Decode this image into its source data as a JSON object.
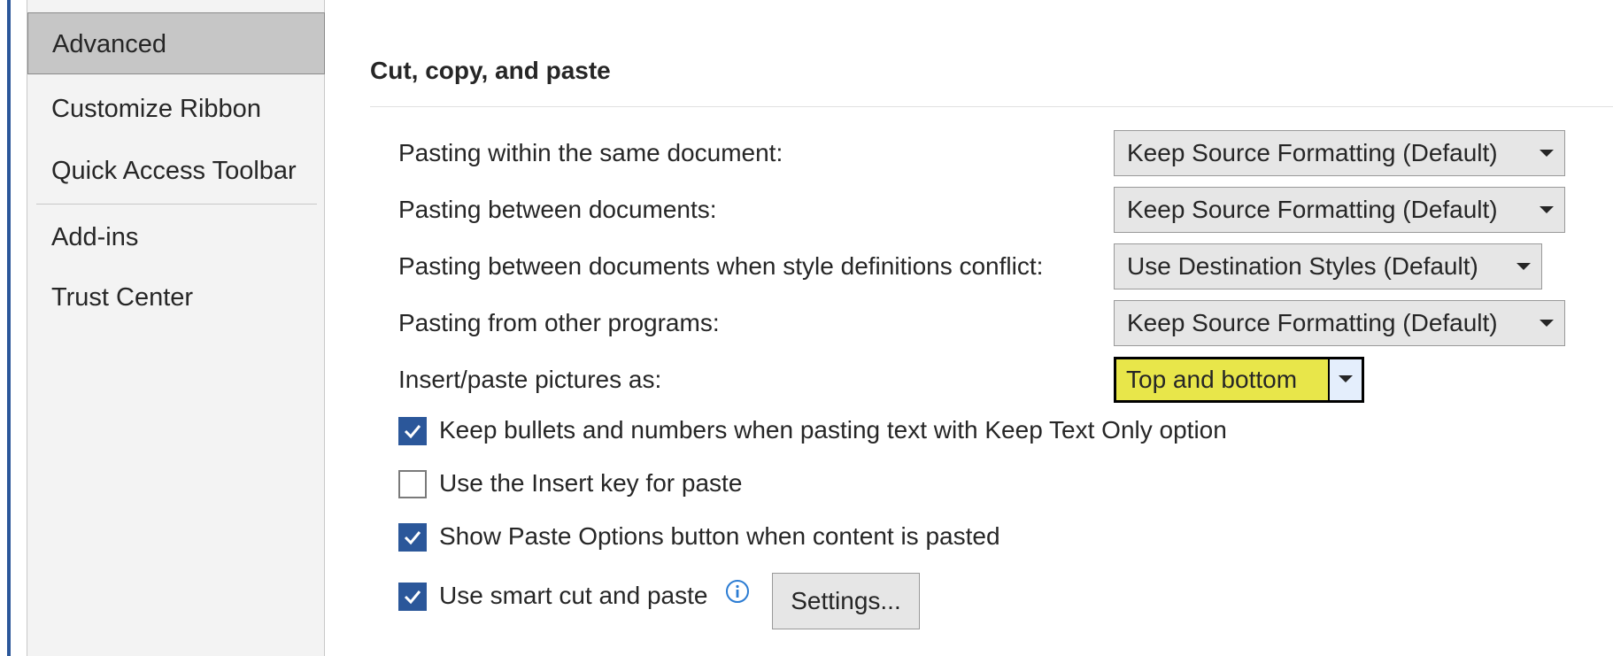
{
  "sidebar": {
    "items": [
      {
        "label": "Advanced"
      },
      {
        "label": "Customize Ribbon"
      },
      {
        "label": "Quick Access Toolbar"
      },
      {
        "label": "Add-ins"
      },
      {
        "label": "Trust Center"
      }
    ]
  },
  "section": {
    "title": "Cut, copy, and paste"
  },
  "paste_options": {
    "within_document": {
      "label": "Pasting within the same document:",
      "value": "Keep Source Formatting (Default)"
    },
    "between_documents": {
      "label": "Pasting between documents:",
      "value": "Keep Source Formatting (Default)"
    },
    "style_conflict": {
      "label": "Pasting between documents when style definitions conflict:",
      "value": "Use Destination Styles (Default)"
    },
    "other_programs": {
      "label": "Pasting from other programs:",
      "value": "Keep Source Formatting (Default)"
    },
    "pictures": {
      "label": "Insert/paste pictures as:",
      "value": "Top and bottom"
    }
  },
  "checkboxes": {
    "keep_bullets": {
      "label": "Keep bullets and numbers when pasting text with Keep Text Only option",
      "checked": true
    },
    "insert_key": {
      "label": "Use the Insert key for paste",
      "checked": false
    },
    "paste_options_button": {
      "label": "Show Paste Options button when content is pasted",
      "checked": true
    },
    "smart_cut": {
      "label": "Use smart cut and paste",
      "checked": true
    }
  },
  "buttons": {
    "settings_label": "Settings..."
  },
  "colors": {
    "accent": "#2b579a",
    "highlight": "#e8e64a",
    "sidebar_bg": "#f3f3f3",
    "selected_bg": "#c6c6c6"
  }
}
